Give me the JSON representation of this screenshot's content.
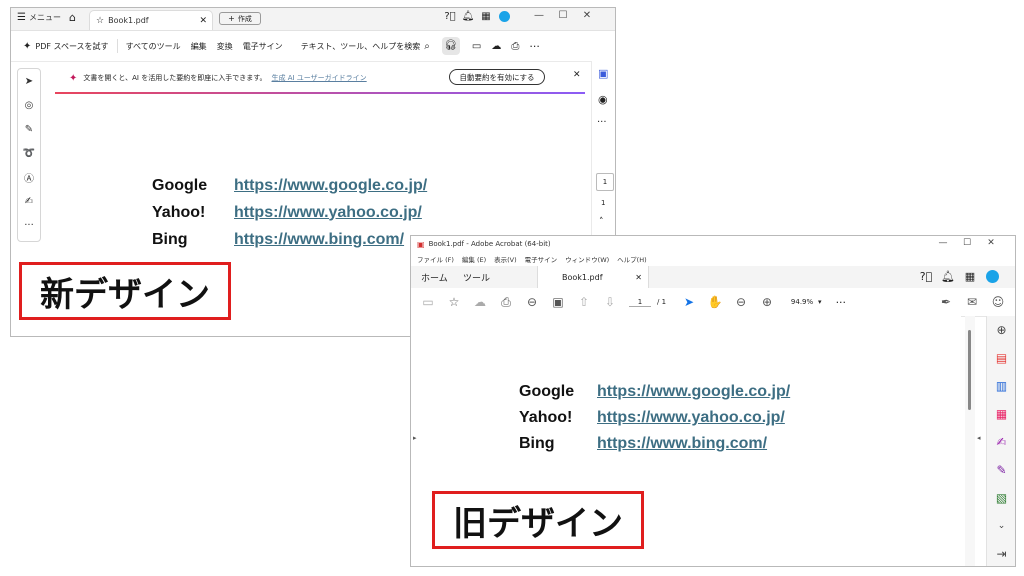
{
  "new_window": {
    "titlebar": {
      "menu_label": "メニュー",
      "tab_title": "Book1.pdf",
      "create_label": "作成"
    },
    "toolbar": {
      "pdf_spaces": "PDF スペースを試す",
      "all_tools": "すべてのツール",
      "edit": "編集",
      "convert": "変換",
      "esign": "電子サイン",
      "search": "テキスト、ツール、ヘルプを検索"
    },
    "banner": {
      "message": "文書を開くと、AI を活用した要約を即座に入手できます。",
      "link": "生成 AI ユーザーガイドライン",
      "button": "自動要約を有効にする"
    },
    "page_input": "1",
    "page_total": "1",
    "links": [
      {
        "name": "Google",
        "url": "https://www.google.co.jp/"
      },
      {
        "name": "Yahoo!",
        "url": "https://www.yahoo.co.jp/"
      },
      {
        "name": "Bing",
        "url": "https://www.bing.com/"
      }
    ]
  },
  "old_window": {
    "title": "Book1.pdf - Adobe Acrobat (64-bit)",
    "menu": [
      "ファイル (F)",
      "編集 (E)",
      "表示(V)",
      "電子サイン",
      "ウィンドウ(W)",
      "ヘルプ(H)"
    ],
    "tabs": {
      "home": "ホーム",
      "tools": "ツール",
      "doc": "Book1.pdf"
    },
    "page_current": "1",
    "page_total": "/ 1",
    "zoom": "94.9%",
    "links": [
      {
        "name": "Google",
        "url": "https://www.google.co.jp/"
      },
      {
        "name": "Yahoo!",
        "url": "https://www.yahoo.co.jp/"
      },
      {
        "name": "Bing",
        "url": "https://www.bing.com/"
      }
    ]
  },
  "labels": {
    "new_design": "新デザイン",
    "old_design": "旧デザイン"
  },
  "colors": {
    "highlight_border": "#e01e1e",
    "link": "#3d6e83",
    "avatar": "#1aa3e8",
    "cursor_tool": "#1473e6"
  }
}
